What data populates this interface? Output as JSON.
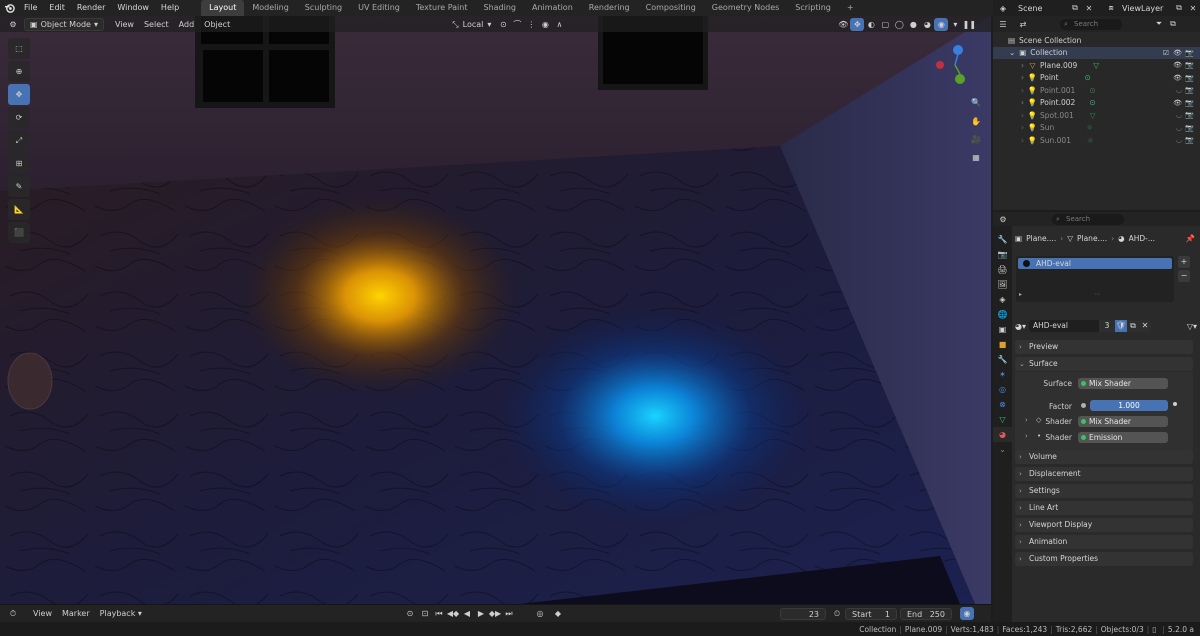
{
  "menu": {
    "items": [
      "File",
      "Edit",
      "Render",
      "Window",
      "Help"
    ],
    "workspaces": [
      "Layout",
      "Modeling",
      "Sculpting",
      "UV Editing",
      "Texture Paint",
      "Shading",
      "Animation",
      "Rendering",
      "Compositing",
      "Geometry Nodes",
      "Scripting"
    ],
    "add_tab": "+"
  },
  "top_right": {
    "scene": "Scene",
    "view_layer": "ViewLayer"
  },
  "viewport_header": {
    "mode": "Object Mode",
    "menus": [
      "View",
      "Select",
      "Add",
      "Object"
    ],
    "transform_orientation": "Local"
  },
  "outliner": {
    "search_placeholder": "Search",
    "scene_collection": "Scene Collection",
    "collection": "Collection",
    "items": [
      {
        "name": "Plane.009",
        "dim": false
      },
      {
        "name": "Point",
        "dim": false
      },
      {
        "name": "Point.001",
        "dim": true
      },
      {
        "name": "Point.002",
        "dim": false
      },
      {
        "name": "Spot.001",
        "dim": true
      },
      {
        "name": "Sun",
        "dim": true
      },
      {
        "name": "Sun.001",
        "dim": true
      }
    ]
  },
  "properties": {
    "search_placeholder": "Search",
    "breadcrumb": [
      "Plane....",
      "Plane....",
      "AHD-..."
    ],
    "slot": "AHD-eval",
    "material_name": "AHD-eval",
    "user_count": "3",
    "panels": {
      "preview": "Preview",
      "surface": "Surface",
      "volume": "Volume",
      "displacement": "Displacement",
      "settings": "Settings",
      "line_art": "Line Art",
      "viewport_display": "Viewport Display",
      "animation": "Animation",
      "custom_properties": "Custom Properties"
    },
    "surface": {
      "surface_label": "Surface",
      "surface_value": "Mix Shader",
      "factor_label": "Factor",
      "factor_value": "1.000",
      "shader1_label": "Shader",
      "shader1_value": "Mix Shader",
      "shader2_label": "Shader",
      "shader2_value": "Emission"
    }
  },
  "timeline": {
    "menus": [
      "View",
      "Marker",
      "Playback"
    ],
    "current_frame": "23",
    "start_label": "Start",
    "start_value": "1",
    "end_label": "End",
    "end_value": "250"
  },
  "statusbar": {
    "collection": "Collection",
    "object": "Plane.009",
    "verts": "Verts:1,483",
    "faces": "Faces:1,243",
    "tris": "Tris:2,662",
    "objects": "Objects:0/3",
    "version": "5.2.0 a"
  },
  "colors": {
    "accent": "#4772b3",
    "active_object": "#e0a030",
    "shader_dot": "#38c26a"
  }
}
